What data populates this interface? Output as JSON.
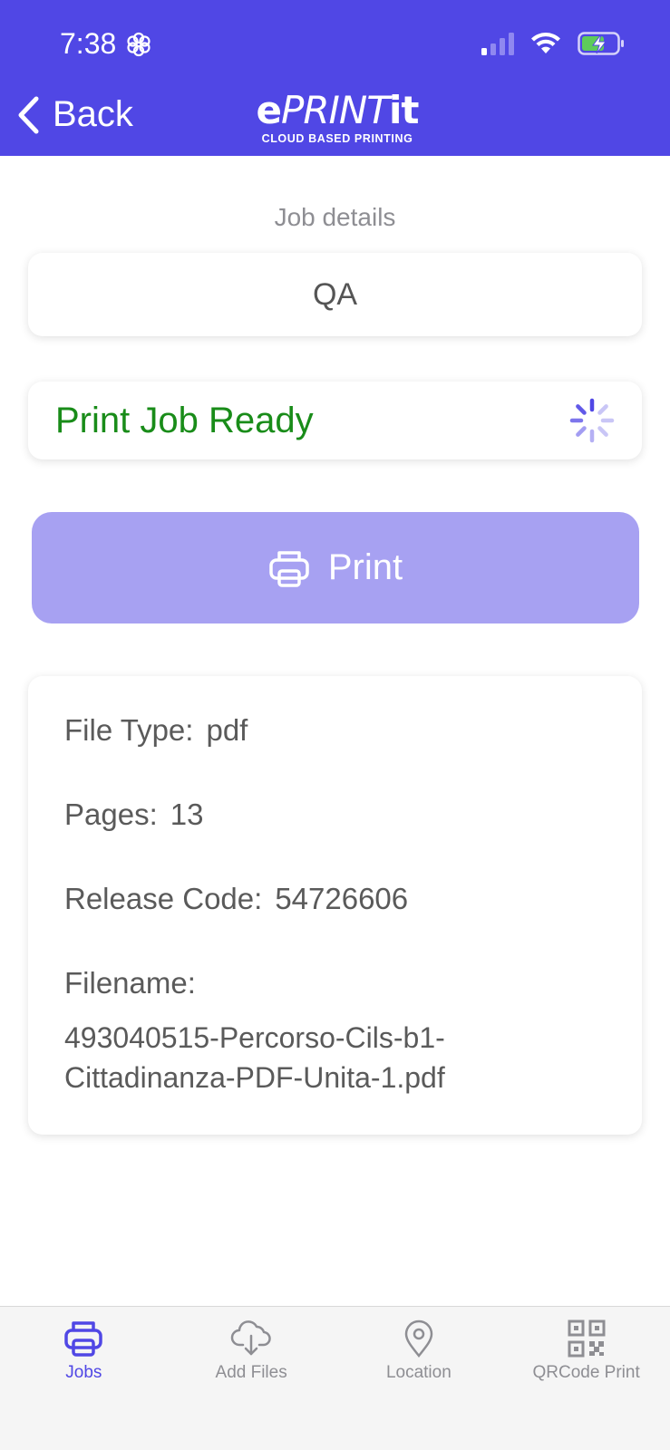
{
  "status_bar": {
    "time": "7:38"
  },
  "header": {
    "back_label": "Back",
    "logo_e": "e",
    "logo_print": "PRINT",
    "logo_it": "it",
    "logo_tagline": "CLOUD BASED PRINTING"
  },
  "job": {
    "section_title": "Job details",
    "name": "QA",
    "status": "Print Job Ready",
    "print_label": "Print",
    "file_type_label": "File Type:",
    "file_type": "pdf",
    "pages_label": "Pages:",
    "pages": "13",
    "release_code_label": "Release Code:",
    "release_code": "54726606",
    "filename_label": "Filename:",
    "filename": "493040515-Percorso-Cils-b1-Cittadinanza-PDF-Unita-1.pdf"
  },
  "tabs": [
    {
      "label": "Jobs",
      "icon": "printer-icon",
      "active": true
    },
    {
      "label": "Add Files",
      "icon": "cloud-download-icon",
      "active": false
    },
    {
      "label": "Location",
      "icon": "location-pin-icon",
      "active": false
    },
    {
      "label": "QRCode Print",
      "icon": "qrcode-icon",
      "active": false
    }
  ],
  "colors": {
    "brand": "#5047e5",
    "button": "#a7a1f2",
    "status_ready": "#198c19"
  }
}
